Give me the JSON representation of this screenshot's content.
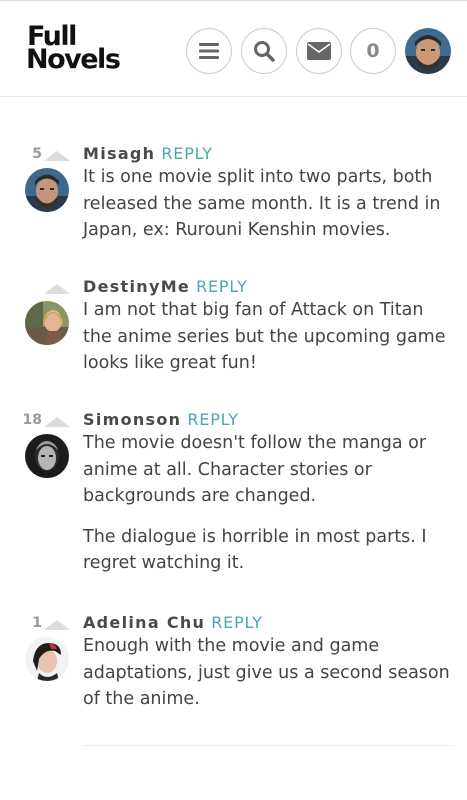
{
  "header": {
    "logo_line1": "Full",
    "logo_line2": "Novels",
    "menu_icon": "hamburger-icon",
    "search_icon": "search-icon",
    "mail_icon": "envelope-icon",
    "notification_count": "0"
  },
  "comments": [
    {
      "votes": "5",
      "author": "Misagh",
      "reply_label": "REPLY",
      "paragraphs": [
        "It is one movie split into two parts, both released the same month. It is a trend in Japan, ex: Rurouni Kenshin movies."
      ]
    },
    {
      "votes": "",
      "author": "DestinyMe",
      "reply_label": "REPLY",
      "paragraphs": [
        "I am not that big fan of Attack on Titan the anime series but the upcoming game looks like great fun!"
      ]
    },
    {
      "votes": "18",
      "author": "Simonson",
      "reply_label": "REPLY",
      "paragraphs": [
        "The movie doesn't follow the manga or anime at all. Character stories or backgrounds are changed.",
        "The dialogue is horrible in most parts. I regret watching it."
      ]
    },
    {
      "votes": "1",
      "author": "Adelina Chu",
      "reply_label": "REPLY",
      "paragraphs": [
        "Enough with the movie and game adaptations, just give us a second season of the anime."
      ]
    }
  ],
  "colors": {
    "accent": "#49a7b3",
    "text": "#444444",
    "muted": "#9a9a9a"
  }
}
